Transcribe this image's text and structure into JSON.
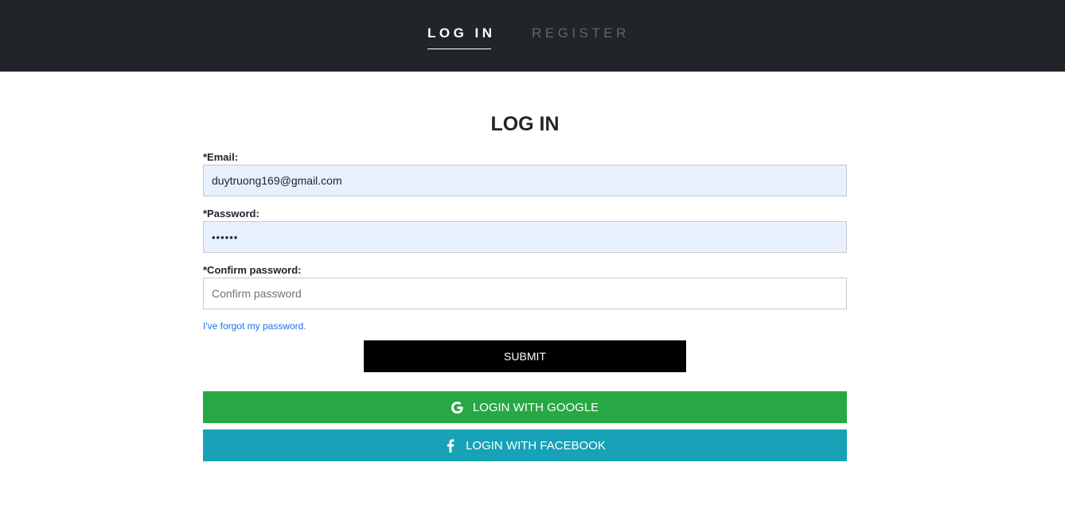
{
  "nav": {
    "login_tab": "LOG IN",
    "register_tab": "REGISTER"
  },
  "form": {
    "title": "LOG IN",
    "email": {
      "label": "*Email:",
      "value": "duytruong169@gmail.com"
    },
    "password": {
      "label": "*Password:",
      "value": "••••••"
    },
    "confirm_password": {
      "label": "*Confirm password:",
      "value": "",
      "placeholder": "Confirm password"
    },
    "forgot_link": "I've forgot my password.",
    "submit_label": "SUBMIT"
  },
  "social": {
    "google": {
      "label": "LOGIN WITH GOOGLE",
      "icon": "google-icon",
      "color": "#28a745"
    },
    "facebook": {
      "label": "LOGIN WITH FACEBOOK",
      "icon": "facebook-icon",
      "color": "#17a2b8"
    }
  },
  "colors": {
    "header_bg": "#212429",
    "autofill_bg": "#e8f0fe",
    "link": "#1a73e8"
  }
}
